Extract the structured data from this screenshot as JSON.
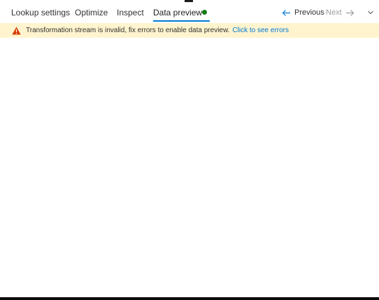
{
  "tabs": {
    "lookup_settings": "Lookup settings",
    "optimize": "Optimize",
    "inspect": "Inspect",
    "data_preview": "Data preview",
    "active": "Data preview",
    "status_color": "#107c10"
  },
  "navigation": {
    "previous_label": "Previous",
    "next_label": "Next",
    "next_enabled": false
  },
  "warning": {
    "message": "Transformation stream is invalid, fix errors to enable data preview.",
    "link_text": "Click to see errors",
    "background": "#fff4ce",
    "icon_color": "#d83b01"
  },
  "colors": {
    "accent": "#0078d4"
  },
  "icons": {
    "previous": "arrow-left-icon",
    "next": "arrow-right-icon",
    "collapse": "chevron-down-icon",
    "warning": "warning-triangle-icon"
  }
}
